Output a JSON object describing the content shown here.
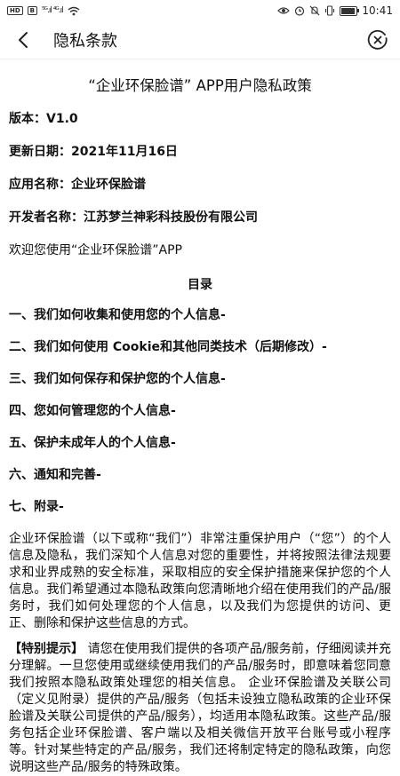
{
  "status_bar": {
    "left_badges": [
      "HD",
      "B"
    ],
    "signal": "⁵ᴳ.ıl ⁴ᴳ.ıl",
    "wifi": "wifi-icon",
    "time": "10:41",
    "battery_level": 0.8
  },
  "header": {
    "title": "隐私条款"
  },
  "document": {
    "title": "“企业环保脸谱” APP用户隐私政策",
    "version": "版本：V1.0",
    "updated": "更新日期：2021年11月16日",
    "app_name": "应用名称：企业环保脸谱",
    "developer": "开发者名称：江苏梦兰神彩科技股份有限公司",
    "welcome": "欢迎您使用“企业环保脸谱”APP",
    "toc_title": "目录",
    "toc": [
      "一、我们如何收集和使用您的个人信息-",
      "二、我们如何使用 Cookie和其他同类技术（后期修改）-",
      "三、我们如何保存和保护您的个人信息-",
      "四、您如何管理您的个人信息-",
      "五、保护未成年人的个人信息-",
      "六、通知和完善-",
      "七、附录-"
    ],
    "intro": "企业环保脸谱（以下或称“我们”）非常注重保护用户（“您”）的个人信息及隐私，我们深知个人信息对您的重要性，并将按照法律法规要求和业界成熟的安全标准，采取相应的安全保护措施来保护您的个人信息。我们希望通过本隐私政策向您清晰地介绍在使用我们的产品/服务时，我们如何处理您的个人信息，以及我们为您提供的访问、更正、删除和保护这些信息的方式。",
    "notice_label": "【特别提示】",
    "notice_text": "请您在使用我们提供的各项产品/服务前，仔细阅读并充分理解。一旦您使用或继续使用我们的产品/服务时，即意味着您同意我们按照本隐私政策处理您的相关信息。 企业环保脸谱及关联公司（定义见附录）提供的产品/服务（包括未设独立隐私政策的企业环保脸谱及关联公司提供的产品/服务），均适用本隐私政策。这些产品/服务包括企业环保脸谱、客户端以及相关微信开放平台账号或小程序等。针对某些特定的产品/服务，我们还将制定特定的隐私政策，向您说明这些产品/服务的特殊政策。"
  }
}
